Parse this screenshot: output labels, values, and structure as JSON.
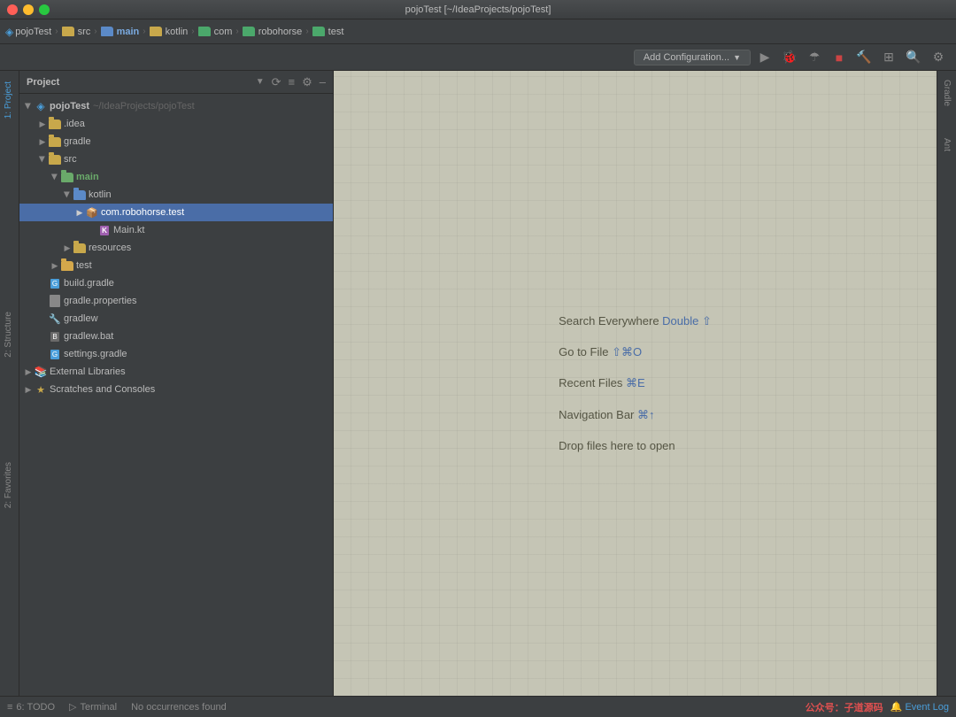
{
  "window": {
    "title": "pojoTest [~/IdeaProjects/pojoTest]",
    "controls": {
      "close": "close",
      "minimize": "minimize",
      "maximize": "maximize"
    }
  },
  "nav_bar": {
    "items": [
      {
        "label": "pojoTest",
        "type": "project"
      },
      {
        "label": "src",
        "type": "folder"
      },
      {
        "label": "main",
        "type": "folder-blue"
      },
      {
        "label": "kotlin",
        "type": "folder"
      },
      {
        "label": "com",
        "type": "folder"
      },
      {
        "label": "robohorse",
        "type": "folder"
      },
      {
        "label": "test",
        "type": "folder"
      }
    ]
  },
  "toolbar": {
    "add_config_label": "Add Configuration...",
    "add_config_arrow": "▼"
  },
  "project_panel": {
    "title": "Project",
    "dropdown_icon": "▼",
    "sync_icon": "⟳",
    "settings_icon": "⚙",
    "collapse_icon": "–"
  },
  "tree": {
    "root": {
      "label": "pojoTest",
      "subtitle": "~/IdeaProjects/pojoTest",
      "expanded": true
    },
    "items": [
      {
        "id": "idea",
        "label": ".idea",
        "type": "folder",
        "depth": 1,
        "expanded": false
      },
      {
        "id": "gradle",
        "label": "gradle",
        "type": "folder",
        "depth": 1,
        "expanded": false
      },
      {
        "id": "src",
        "label": "src",
        "type": "folder",
        "depth": 1,
        "expanded": true
      },
      {
        "id": "main",
        "label": "main",
        "type": "folder-source",
        "depth": 2,
        "expanded": true
      },
      {
        "id": "kotlin",
        "label": "kotlin",
        "type": "folder-blue",
        "depth": 3,
        "expanded": true
      },
      {
        "id": "com_package",
        "label": "com.robohorse.test",
        "type": "package",
        "depth": 4,
        "expanded": false,
        "selected": true
      },
      {
        "id": "main_kt",
        "label": "Main.kt",
        "type": "kotlin",
        "depth": 5,
        "expanded": false
      },
      {
        "id": "resources",
        "label": "resources",
        "type": "folder",
        "depth": 3,
        "expanded": false
      },
      {
        "id": "test",
        "label": "test",
        "type": "folder-light",
        "depth": 2,
        "expanded": false
      },
      {
        "id": "build_gradle",
        "label": "build.gradle",
        "type": "gradle",
        "depth": 1
      },
      {
        "id": "gradle_props",
        "label": "gradle.properties",
        "type": "properties",
        "depth": 1
      },
      {
        "id": "gradlew",
        "label": "gradlew",
        "type": "script",
        "depth": 1
      },
      {
        "id": "gradlew_bat",
        "label": "gradlew.bat",
        "type": "bat",
        "depth": 1
      },
      {
        "id": "settings_gradle",
        "label": "settings.gradle",
        "type": "gradle",
        "depth": 1
      },
      {
        "id": "external_libs",
        "label": "External Libraries",
        "type": "library",
        "depth": 0,
        "expanded": false
      },
      {
        "id": "scratches",
        "label": "Scratches and Consoles",
        "type": "scratches",
        "depth": 0,
        "expanded": false
      }
    ]
  },
  "editor": {
    "hints": [
      {
        "text": "Search Everywhere",
        "shortcut": "Double ⇧",
        "shortcut_colored": true
      },
      {
        "text": "Go to File",
        "shortcut": "⇧⌘O",
        "shortcut_colored": true
      },
      {
        "text": "Recent Files",
        "shortcut": "⌘E",
        "shortcut_colored": true
      },
      {
        "text": "Navigation Bar",
        "shortcut": "⌘↑",
        "shortcut_colored": true
      },
      {
        "text": "Drop files here to open",
        "shortcut": "",
        "shortcut_colored": false
      }
    ]
  },
  "right_tabs": [
    {
      "label": "Gradle"
    },
    {
      "label": "Ant"
    }
  ],
  "left_sidebar_tabs": [
    {
      "label": "1: Project",
      "active": true
    },
    {
      "label": "2: Structure"
    },
    {
      "label": "2: Favorites"
    }
  ],
  "status_bar": {
    "todo_label": "6: TODO",
    "terminal_label": "Terminal",
    "no_occurrences": "No occurrences found",
    "watermark": "公众号：子道源码",
    "event_log": "Event Log"
  }
}
